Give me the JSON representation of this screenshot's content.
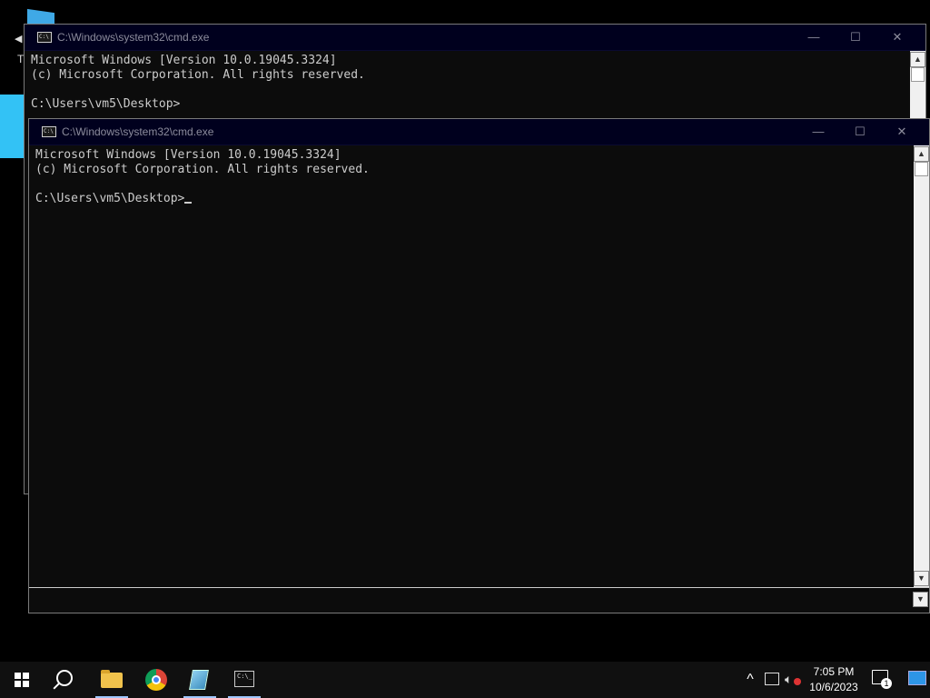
{
  "desktop": {
    "partial_letter": "T"
  },
  "back_window": {
    "title": "C:\\Windows\\system32\\cmd.exe",
    "lines": [
      "Microsoft Windows [Version 10.0.19045.3324]",
      "(c) Microsoft Corporation. All rights reserved.",
      "",
      "C:\\Users\\vm5\\Desktop>"
    ],
    "controls": {
      "minimize": "—",
      "maximize": "☐",
      "close": "✕"
    }
  },
  "front_window": {
    "title": "C:\\Windows\\system32\\cmd.exe",
    "lines": [
      "Microsoft Windows [Version 10.0.19045.3324]",
      "(c) Microsoft Corporation. All rights reserved.",
      ""
    ],
    "prompt": "C:\\Users\\vm5\\Desktop>",
    "controls": {
      "minimize": "—",
      "maximize": "☐",
      "close": "✕"
    }
  },
  "taskbar": {
    "items": [
      {
        "icon": "windows-start-icon"
      },
      {
        "icon": "search-icon"
      },
      {
        "icon": "file-explorer-icon",
        "active": true
      },
      {
        "icon": "chrome-icon"
      },
      {
        "icon": "notepad-icon",
        "active": true
      },
      {
        "icon": "command-prompt-icon",
        "active": true
      }
    ],
    "tray": {
      "chevron": "^",
      "time": "7:05 PM",
      "date": "10/6/2023",
      "notification_count": "1"
    }
  }
}
